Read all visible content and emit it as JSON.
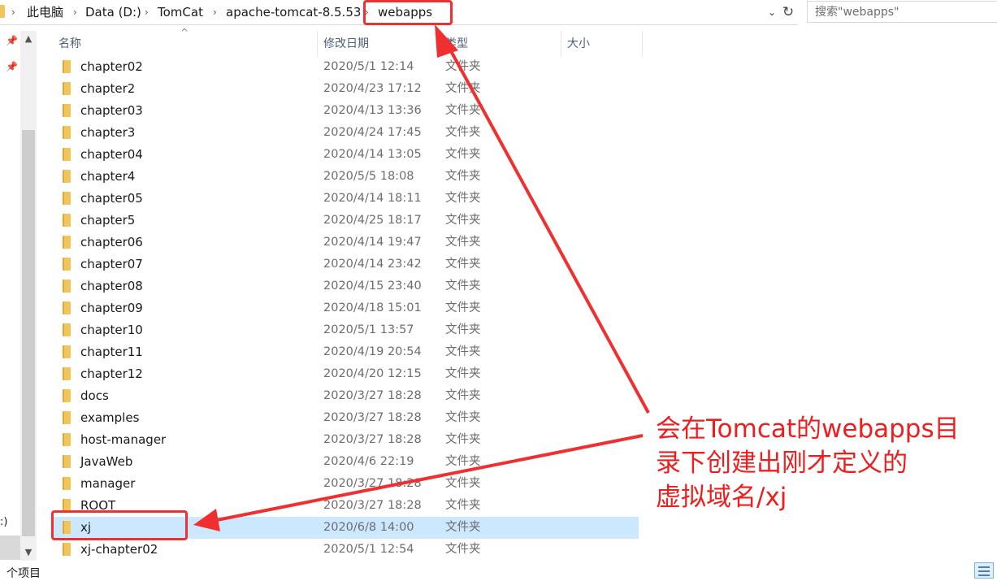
{
  "address_bar": {
    "breadcrumb": [
      "此电脑",
      "Data (D:)",
      "TomCat",
      "apache-tomcat-8.5.53",
      "webapps"
    ],
    "dropdown_glyph": "⌄",
    "refresh_glyph": "↻"
  },
  "search": {
    "placeholder": "搜索\"webapps\""
  },
  "nav": {
    "partial_label": ":)"
  },
  "columns": {
    "name": "名称",
    "date": "修改日期",
    "type": "类型",
    "size": "大小"
  },
  "files": [
    {
      "name": "chapter02",
      "date": "2020/5/1 12:14",
      "type": "文件夹"
    },
    {
      "name": "chapter2",
      "date": "2020/4/23 17:12",
      "type": "文件夹"
    },
    {
      "name": "chapter03",
      "date": "2020/4/13 13:36",
      "type": "文件夹"
    },
    {
      "name": "chapter3",
      "date": "2020/4/24 17:45",
      "type": "文件夹"
    },
    {
      "name": "chapter04",
      "date": "2020/4/14 13:05",
      "type": "文件夹"
    },
    {
      "name": "chapter4",
      "date": "2020/5/5 18:08",
      "type": "文件夹"
    },
    {
      "name": "chapter05",
      "date": "2020/4/14 18:11",
      "type": "文件夹"
    },
    {
      "name": "chapter5",
      "date": "2020/4/25 18:17",
      "type": "文件夹"
    },
    {
      "name": "chapter06",
      "date": "2020/4/14 19:47",
      "type": "文件夹"
    },
    {
      "name": "chapter07",
      "date": "2020/4/14 23:42",
      "type": "文件夹"
    },
    {
      "name": "chapter08",
      "date": "2020/4/15 23:40",
      "type": "文件夹"
    },
    {
      "name": "chapter09",
      "date": "2020/4/18 15:01",
      "type": "文件夹"
    },
    {
      "name": "chapter10",
      "date": "2020/5/1 13:57",
      "type": "文件夹"
    },
    {
      "name": "chapter11",
      "date": "2020/4/19 20:54",
      "type": "文件夹"
    },
    {
      "name": "chapter12",
      "date": "2020/4/20 12:15",
      "type": "文件夹"
    },
    {
      "name": "docs",
      "date": "2020/3/27 18:28",
      "type": "文件夹"
    },
    {
      "name": "examples",
      "date": "2020/3/27 18:28",
      "type": "文件夹"
    },
    {
      "name": "host-manager",
      "date": "2020/3/27 18:28",
      "type": "文件夹"
    },
    {
      "name": "JavaWeb",
      "date": "2020/4/6 22:19",
      "type": "文件夹"
    },
    {
      "name": "manager",
      "date": "2020/3/27 18:28",
      "type": "文件夹"
    },
    {
      "name": "ROOT",
      "date": "2020/3/27 18:28",
      "type": "文件夹"
    },
    {
      "name": "xj",
      "date": "2020/6/8 14:00",
      "type": "文件夹",
      "selected": true
    },
    {
      "name": "xj-chapter02",
      "date": "2020/5/1 12:54",
      "type": "文件夹"
    }
  ],
  "status": {
    "item_count": "个项目"
  },
  "annotation": {
    "text": "会在Tomcat的webapps目\n录下创建出刚才定义的\n虚拟域名/xj",
    "color": "#ee1e1e"
  },
  "colors": {
    "selection": "#cce8ff",
    "header_text": "#4c607a",
    "folder": "#f2c55c"
  }
}
